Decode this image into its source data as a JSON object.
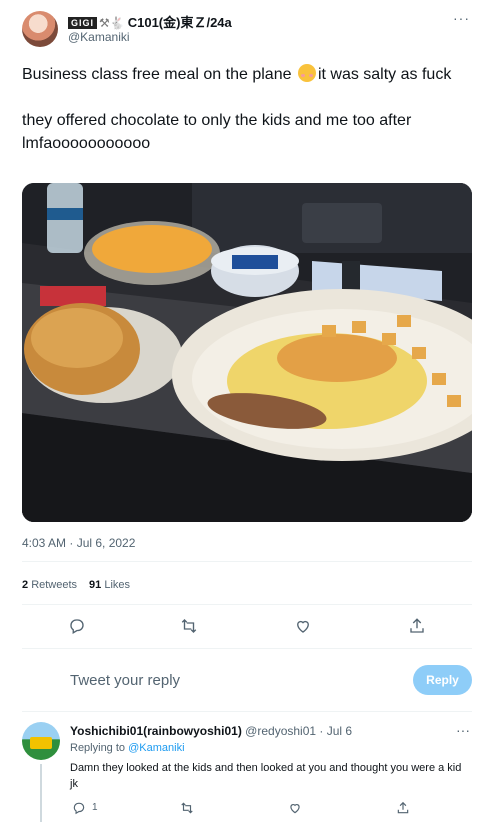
{
  "tweet": {
    "author_badge": "GIGI",
    "author_name_suffix": "C101(金)東Ｚ/24a",
    "author_handle": "@Kamaniki",
    "text_part1": "Business class free meal on the plane ",
    "text_part2": "it was salty as fuck\n\nthey offered chocolate to only the kids and me too after lmfaooooooooooo",
    "timestamp": "4:03 AM · Jul 6, 2022",
    "retweets": "2",
    "retweets_label": "Retweets",
    "likes": "91",
    "likes_label": "Likes"
  },
  "composer": {
    "placeholder": "Tweet your reply",
    "button_label": "Reply"
  },
  "reply": {
    "name": "Yoshichibi01(rainbowyoshi01)",
    "meta": "@redyoshi01 · Jul 6",
    "replying_to_label": "Replying to",
    "replying_to_handle": "@Kamaniki",
    "text": "Damn they looked at the kids and then looked at you and thought you were a kid jk",
    "reply_count": "1"
  },
  "icons": {
    "more": "more-icon",
    "reply": "reply-icon",
    "retweet": "retweet-icon",
    "like": "heart-icon",
    "share": "share-icon"
  },
  "colors": {
    "accent": "#1d9bf0",
    "reply_button": "#8ecdf8",
    "secondary_text": "#536471"
  }
}
